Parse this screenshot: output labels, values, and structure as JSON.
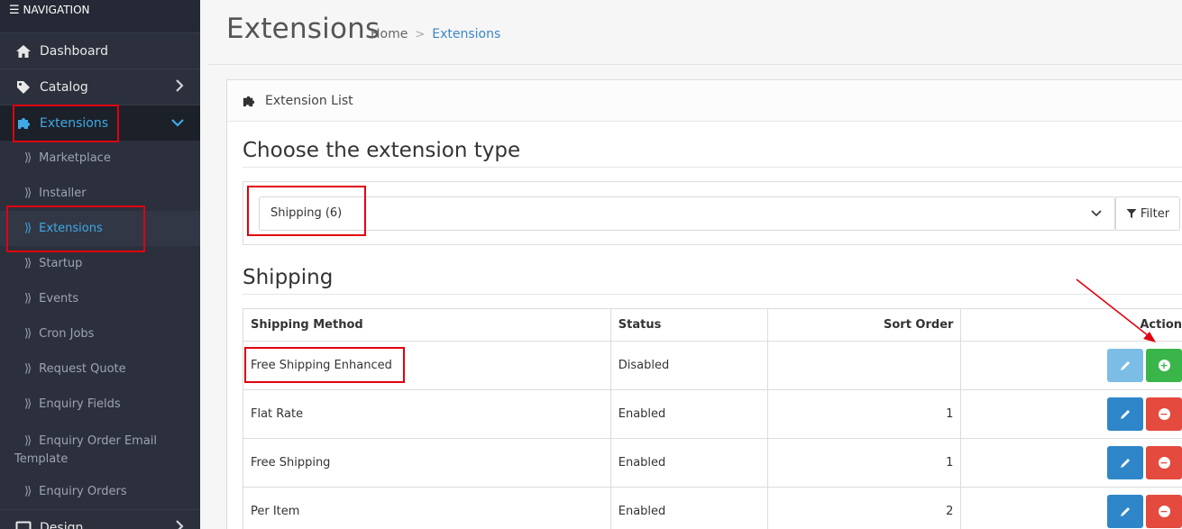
{
  "sidebar": {
    "header": "NAVIGATION",
    "items": [
      {
        "label": "Dashboard",
        "icon": "home-icon"
      },
      {
        "label": "Catalog",
        "icon": "tag-icon"
      },
      {
        "label": "Extensions",
        "icon": "puzzle-icon"
      }
    ],
    "sub_items": [
      {
        "label": "Marketplace"
      },
      {
        "label": "Installer"
      },
      {
        "label": "Extensions"
      },
      {
        "label": "Startup"
      },
      {
        "label": "Events"
      },
      {
        "label": "Cron Jobs"
      },
      {
        "label": "Request Quote"
      },
      {
        "label": "Enquiry Fields"
      },
      {
        "label": "Enquiry Order Email Template"
      },
      {
        "label": "Enquiry Orders"
      }
    ],
    "next_item": {
      "label": "Design"
    }
  },
  "header": {
    "title": "Extensions",
    "breadcrumb": [
      "Home",
      "Extensions"
    ]
  },
  "panel": {
    "heading": "Extension List",
    "choose_title": "Choose the extension type",
    "select_value": "Shipping (6)",
    "filter_label": "Filter",
    "section_title": "Shipping"
  },
  "table": {
    "columns": [
      "Shipping Method",
      "Status",
      "Sort Order",
      "Action"
    ],
    "rows": [
      {
        "method": "Free Shipping Enhanced",
        "status": "Disabled",
        "sort": "",
        "installed": false
      },
      {
        "method": "Flat Rate",
        "status": "Enabled",
        "sort": "1",
        "installed": true
      },
      {
        "method": "Free Shipping",
        "status": "Enabled",
        "sort": "1",
        "installed": true
      },
      {
        "method": "Per Item",
        "status": "Enabled",
        "sort": "2",
        "installed": true
      }
    ]
  },
  "colors": {
    "sidebar_bg": "#2b303c",
    "accent_blue": "#3fa9e6",
    "install_green": "#3ab54a",
    "uninstall_red": "#e44a3d",
    "highlight_red": "#e1000f"
  }
}
